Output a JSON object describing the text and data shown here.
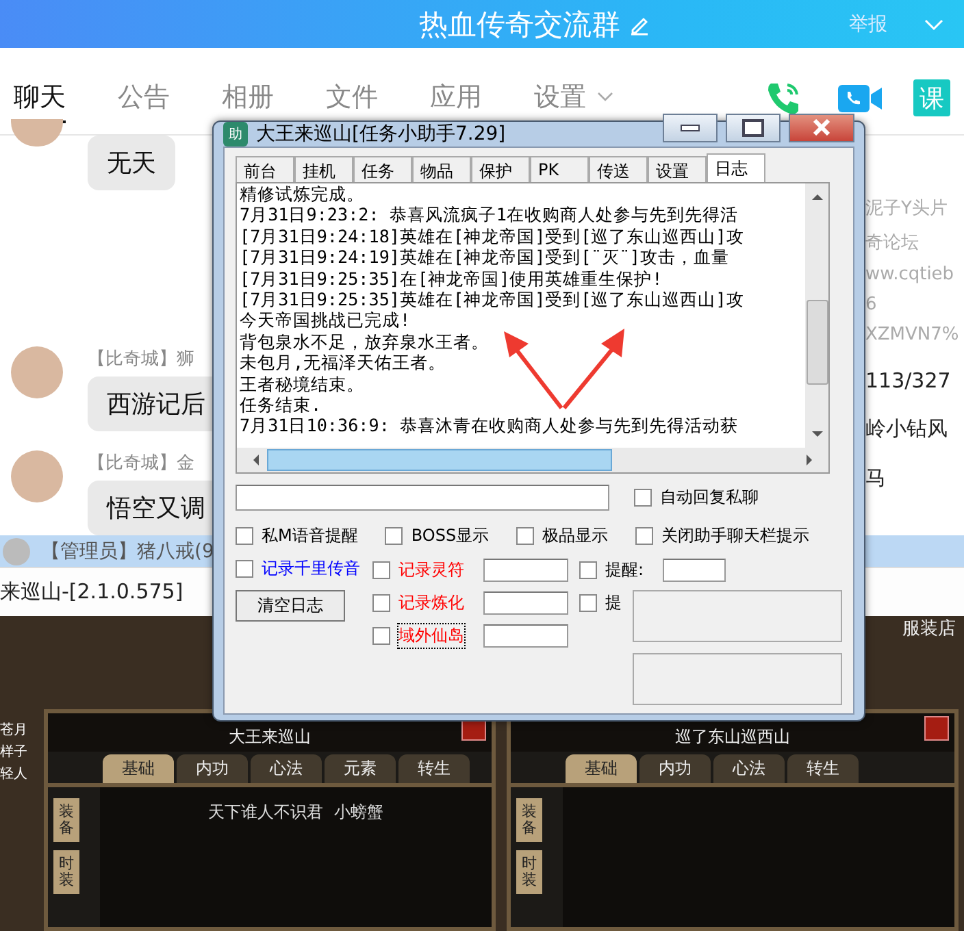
{
  "chat_window": {
    "title": "热血传奇交流群",
    "report": "举报",
    "tabs": [
      {
        "label": "聊天",
        "selected": true,
        "menu": false
      },
      {
        "label": "公告",
        "selected": false,
        "menu": false
      },
      {
        "label": "相册",
        "selected": false,
        "menu": false
      },
      {
        "label": "文件",
        "selected": false,
        "menu": false
      },
      {
        "label": "应用",
        "selected": false,
        "menu": false
      },
      {
        "label": "设置",
        "selected": false,
        "menu": true
      }
    ],
    "course_badge": "课",
    "messages": [
      {
        "text": "无天"
      },
      {
        "sender": "【比奇城】狮",
        "text": "西游记后"
      },
      {
        "sender": "【比奇城】金",
        "text": "悟空又调"
      }
    ],
    "side_texts": [
      "泥子Y头片",
      "奇论坛",
      "ww.cqtieb",
      "6",
      "XZMVN7%",
      "113/327",
      "岭小钻风",
      "马"
    ],
    "admin_bar": {
      "sender": "【管理员】猪八戒(9"
    }
  },
  "game": {
    "title": "来巡山-[2.1.0.575]",
    "edge_names": [
      "苍月",
      "样子",
      "轻人"
    ],
    "shop": "服装店",
    "panels": [
      {
        "name": "大王来巡山",
        "tabs": [
          {
            "label": "基础",
            "selected": true
          },
          {
            "label": "内功",
            "selected": false
          },
          {
            "label": "心法",
            "selected": false
          },
          {
            "label": "元素",
            "selected": false
          },
          {
            "label": "转生",
            "selected": false
          }
        ],
        "side_tabs": [
          "装备",
          "时装"
        ],
        "motto": "天下谁人不识君  小螃蟹"
      },
      {
        "name": "巡了东山巡西山",
        "tabs": [
          {
            "label": "基础",
            "selected": true
          },
          {
            "label": "内功",
            "selected": false
          },
          {
            "label": "心法",
            "selected": false
          },
          {
            "label": "转生",
            "selected": false
          }
        ],
        "side_tabs": [
          "装备",
          "时装"
        ]
      }
    ]
  },
  "helper": {
    "title": "大王来巡山[任务小助手7.29]",
    "app_icon": "助",
    "tabs": [
      {
        "label": "前台",
        "selected": false
      },
      {
        "label": "挂机",
        "selected": false
      },
      {
        "label": "任务",
        "selected": false
      },
      {
        "label": "物品",
        "selected": false
      },
      {
        "label": "保护",
        "selected": false
      },
      {
        "label": "PK",
        "selected": false
      },
      {
        "label": "传送",
        "selected": false
      },
      {
        "label": "设置",
        "selected": false
      },
      {
        "label": "日志",
        "selected": true
      }
    ],
    "log": [
      "精修试炼完成。",
      "7月31日9:23:2: 恭喜风流疯子1在收购商人处参与先到先得活",
      "[7月31日9:24:18]英雄在[神龙帝国]受到[巡了东山巡西山]攻",
      "[7月31日9:24:19]英雄在[神龙帝国]受到[¨灭¨]攻击，血量",
      "[7月31日9:25:35]在[神龙帝国]使用英雄重生保护!",
      "[7月31日9:25:35]英雄在[神龙帝国]受到[巡了东山巡西山]攻",
      "今天帝国挑战已完成!",
      "背包泉水不足，放弃泉水王者。",
      "未包月,无福泽天佑王者。",
      "王者秘境结束。",
      "任务结束.",
      "7月31日10:36:9: 恭喜沐青在收购商人处参与先到先得活动获"
    ],
    "auto_reply": {
      "label": "自动回复私聊",
      "checked": false
    },
    "options": [
      {
        "label": "私M语音提醒",
        "checked": false
      },
      {
        "label": "BOSS显示",
        "checked": false
      },
      {
        "label": "极品显示",
        "checked": false
      },
      {
        "label": "关闭助手聊天栏提示",
        "checked": false
      }
    ],
    "voice_record": {
      "label": "记录千里传音",
      "checked": false,
      "color": "#0000ff"
    },
    "clear_button": "清空日志",
    "records": [
      {
        "label": "记录灵符",
        "checked": false,
        "color": "#ff0000",
        "focused": false,
        "alert": {
          "label": "提醒:",
          "checked": false,
          "field": true
        }
      },
      {
        "label": "记录炼化",
        "checked": false,
        "color": "#ff0000",
        "focused": false,
        "alert": {
          "label": "提",
          "checked": false,
          "field": false
        }
      },
      {
        "label": "域外仙岛",
        "checked": false,
        "color": "#ff0000",
        "focused": true
      }
    ]
  }
}
